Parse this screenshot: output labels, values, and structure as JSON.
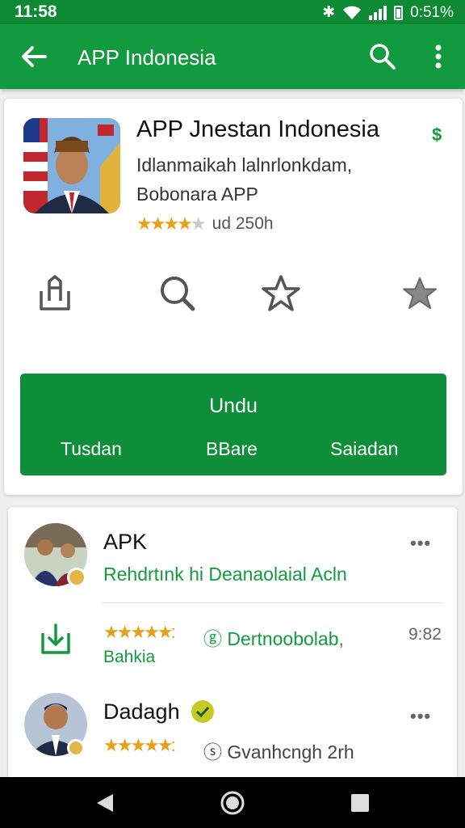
{
  "status_bar": {
    "time": "11:58",
    "battery": "0:51%"
  },
  "app_bar": {
    "title": "APP Indonesia",
    "back_icon": "arrow-back-icon",
    "search_icon": "search-icon",
    "more_icon": "more-vertical-icon"
  },
  "app": {
    "title": "APP Jnestan Indonesia",
    "price_symbol": "$",
    "subtitle_line1": "Idlanmaikah lalnrlonkdam,",
    "subtitle_line2": "Bobonara APP",
    "rating": 3.5,
    "rating_text": "ud 250h"
  },
  "actions": [
    {
      "icon": "share-icon"
    },
    {
      "icon": "search-icon"
    },
    {
      "icon": "star-outline-icon"
    },
    {
      "icon": "star-filled-icon"
    }
  ],
  "install_button": {
    "label": "Undu",
    "options": [
      "Tusdan",
      "BBare",
      "Saiadan"
    ]
  },
  "reviews": [
    {
      "name": "APK",
      "text": "Rehdrtınk hi Deanaolaial Acln",
      "meta_stars": "★★★★★:",
      "meta_text": "ⓖ Dertnoobolab,",
      "meta_line2": "Bahkia",
      "time": "9:82"
    },
    {
      "name": "Dadagh",
      "meta_stars": "★★★★★:",
      "meta_text": "ⓢ Gvanhcngh 2rh"
    }
  ],
  "colors": {
    "primary": "#129a3f",
    "status": "#0e8a35",
    "star": "#e6a117"
  }
}
